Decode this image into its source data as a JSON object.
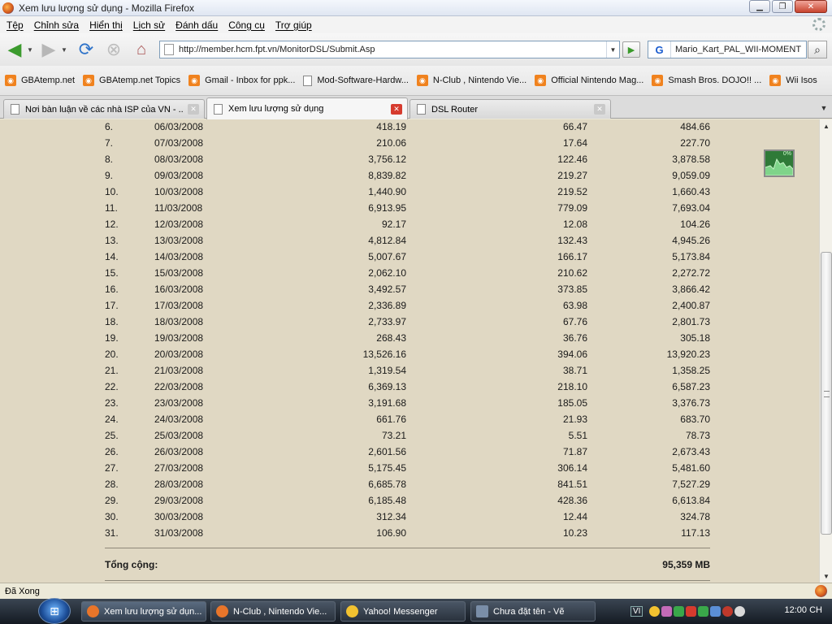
{
  "window": {
    "title": "Xem lưu lượng sử dụng - Mozilla Firefox",
    "min_icon": "minimize-icon",
    "max_icon": "maximize-icon",
    "close_icon": "close-icon"
  },
  "menu": [
    "Tệp",
    "Chỉnh sửa",
    "Hiển thị",
    "Lịch sử",
    "Đánh dấu",
    "Công cụ",
    "Trợ giúp"
  ],
  "nav": {
    "url": "http://member.hcm.fpt.vn/MonitorDSL/Submit.Asp",
    "search_engine": "G",
    "search_value": "Mario_Kart_PAL_WII-MOMENT"
  },
  "bookmarks": [
    {
      "label": "GBAtemp.net",
      "icon": "rss-icon"
    },
    {
      "label": "GBAtemp.net Topics",
      "icon": "rss-icon"
    },
    {
      "label": "Gmail - Inbox for ppk...",
      "icon": "rss-icon"
    },
    {
      "label": "Mod-Software-Hardw...",
      "icon": "page-icon"
    },
    {
      "label": "N-Club , Nintendo Vie...",
      "icon": "rss-icon"
    },
    {
      "label": "Official Nintendo Mag...",
      "icon": "rss-icon"
    },
    {
      "label": "Smash Bros. DOJO!! ...",
      "icon": "rss-icon"
    },
    {
      "label": "Wii Isos",
      "icon": "rss-icon"
    }
  ],
  "tabs": [
    {
      "label": "Nơi bàn luận về các nhà ISP của VN - ..."
    },
    {
      "label": "Xem lưu lượng sử dụng"
    },
    {
      "label": "DSL Router"
    }
  ],
  "usage_rows": [
    [
      "6.",
      "06/03/2008",
      "418.19",
      "66.47",
      "484.66"
    ],
    [
      "7.",
      "07/03/2008",
      "210.06",
      "17.64",
      "227.70"
    ],
    [
      "8.",
      "08/03/2008",
      "3,756.12",
      "122.46",
      "3,878.58"
    ],
    [
      "9.",
      "09/03/2008",
      "8,839.82",
      "219.27",
      "9,059.09"
    ],
    [
      "10.",
      "10/03/2008",
      "1,440.90",
      "219.52",
      "1,660.43"
    ],
    [
      "11.",
      "11/03/2008",
      "6,913.95",
      "779.09",
      "7,693.04"
    ],
    [
      "12.",
      "12/03/2008",
      "92.17",
      "12.08",
      "104.26"
    ],
    [
      "13.",
      "13/03/2008",
      "4,812.84",
      "132.43",
      "4,945.26"
    ],
    [
      "14.",
      "14/03/2008",
      "5,007.67",
      "166.17",
      "5,173.84"
    ],
    [
      "15.",
      "15/03/2008",
      "2,062.10",
      "210.62",
      "2,272.72"
    ],
    [
      "16.",
      "16/03/2008",
      "3,492.57",
      "373.85",
      "3,866.42"
    ],
    [
      "17.",
      "17/03/2008",
      "2,336.89",
      "63.98",
      "2,400.87"
    ],
    [
      "18.",
      "18/03/2008",
      "2,733.97",
      "67.76",
      "2,801.73"
    ],
    [
      "19.",
      "19/03/2008",
      "268.43",
      "36.76",
      "305.18"
    ],
    [
      "20.",
      "20/03/2008",
      "13,526.16",
      "394.06",
      "13,920.23"
    ],
    [
      "21.",
      "21/03/2008",
      "1,319.54",
      "38.71",
      "1,358.25"
    ],
    [
      "22.",
      "22/03/2008",
      "6,369.13",
      "218.10",
      "6,587.23"
    ],
    [
      "23.",
      "23/03/2008",
      "3,191.68",
      "185.05",
      "3,376.73"
    ],
    [
      "24.",
      "24/03/2008",
      "661.76",
      "21.93",
      "683.70"
    ],
    [
      "25.",
      "25/03/2008",
      "73.21",
      "5.51",
      "78.73"
    ],
    [
      "26.",
      "26/03/2008",
      "2,601.56",
      "71.87",
      "2,673.43"
    ],
    [
      "27.",
      "27/03/2008",
      "5,175.45",
      "306.14",
      "5,481.60"
    ],
    [
      "28.",
      "28/03/2008",
      "6,685.78",
      "841.51",
      "7,527.29"
    ],
    [
      "29.",
      "29/03/2008",
      "6,185.48",
      "428.36",
      "6,613.84"
    ],
    [
      "30.",
      "30/03/2008",
      "312.34",
      "12.44",
      "324.78"
    ],
    [
      "31.",
      "31/03/2008",
      "106.90",
      "10.23",
      "117.13"
    ]
  ],
  "total": {
    "label": "Tổng cộng:",
    "value": "95,359 MB"
  },
  "meter": {
    "percent_text": "0%",
    "icon": "network-meter-icon"
  },
  "status": {
    "text": "Đã Xong"
  },
  "taskbar": {
    "tasks": [
      {
        "label": "Xem lưu lượng sử dụn...",
        "color": "#e8752a"
      },
      {
        "label": "N-Club , Nintendo Vie...",
        "color": "#e8752a"
      },
      {
        "label": "Yahoo! Messenger",
        "color": "#f2c230"
      },
      {
        "label": "Chưa đặt tên - Vẽ",
        "color": "#7a8ea8"
      }
    ],
    "tray_lang": "VI",
    "clock": "12:00 CH"
  }
}
